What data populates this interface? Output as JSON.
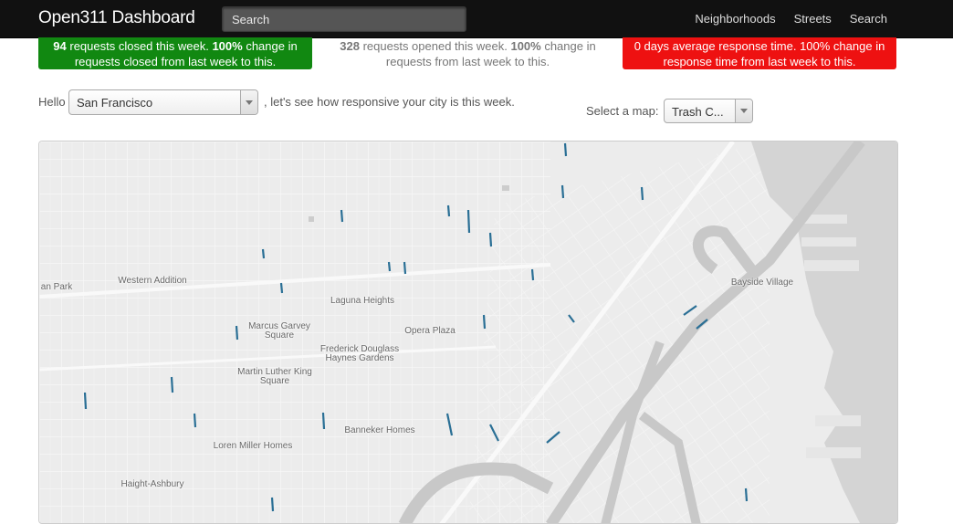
{
  "header": {
    "brand": "Open311 Dashboard",
    "search_placeholder": "Search",
    "nav": [
      "Neighborhoods",
      "Streets",
      "Search"
    ]
  },
  "stats": {
    "closed": {
      "count": "94",
      "text1": " requests closed this week. ",
      "pct": "100%",
      "text2": " change in requests closed from last week to this.",
      "color": "#118811"
    },
    "opened": {
      "count": "328",
      "text1": " requests opened this week. ",
      "pct": "100%",
      "text2": " change in requests from last week to this."
    },
    "response": {
      "text": "0 days average response time. 100% change in response time from last week to this.",
      "color": "#ee1111"
    }
  },
  "controls": {
    "hello": "Hello",
    "city": "San Francisco",
    "tagline": ", let's see how responsive your city is this week.",
    "map_label": "Select a map:",
    "map_value": "Trash C..."
  },
  "map": {
    "segment_color": "#2a6f95",
    "places": [
      "an Park",
      "Western Addition",
      "Laguna Heights",
      "Marcus Garvey Square",
      "Opera Plaza",
      "Frederick Douglass Haynes Gardens",
      "Martin Luther King Square",
      "Banneker Homes",
      "Loren Miller Homes",
      "Haight-Ashbury",
      "Bayside Village"
    ]
  }
}
